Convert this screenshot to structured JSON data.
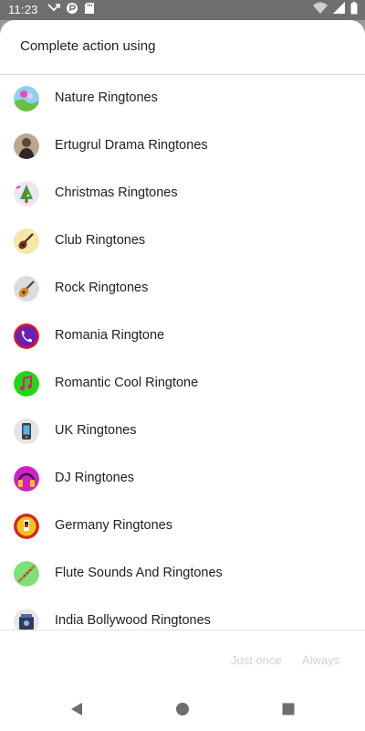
{
  "status_bar": {
    "time": "11:23",
    "left_icons": [
      "missed-call-icon",
      "sync-icon",
      "sd-card-icon"
    ],
    "right_icons": [
      "wifi-icon",
      "signal-icon",
      "battery-icon"
    ]
  },
  "dialog": {
    "title": "Complete action using",
    "apps": [
      {
        "label": "Nature Ringtones",
        "icon": "nature-app-icon"
      },
      {
        "label": "Ertugrul Drama Ringtones",
        "icon": "ertugrul-app-icon"
      },
      {
        "label": "Christmas Ringtones",
        "icon": "christmas-tree-app-icon"
      },
      {
        "label": "Club Ringtones",
        "icon": "guitar-app-icon"
      },
      {
        "label": "Rock Ringtones",
        "icon": "rock-guitar-app-icon"
      },
      {
        "label": "Romania Ringtone",
        "icon": "phone-app-icon"
      },
      {
        "label": "Romantic Cool Ringtone",
        "icon": "music-note-app-icon"
      },
      {
        "label": "UK Ringtones",
        "icon": "mobile-phone-app-icon"
      },
      {
        "label": "DJ Ringtones",
        "icon": "headphones-app-icon"
      },
      {
        "label": "Germany Ringtones",
        "icon": "flag-app-icon"
      },
      {
        "label": "Flute Sounds And Ringtones",
        "icon": "flute-app-icon"
      },
      {
        "label": "India Bollywood Ringtones",
        "icon": "bollywood-app-icon"
      }
    ],
    "buttons": {
      "just_once": "Just once",
      "always": "Always"
    }
  },
  "nav_bar": {
    "buttons": [
      "back-icon",
      "home-icon",
      "recents-icon"
    ]
  },
  "colors": {
    "status_bar": "#6f6f6f",
    "scrim": "#9a9a9a",
    "sheet": "#ffffff",
    "text": "#202124",
    "disabled_button_text": "#d2d2d2"
  }
}
